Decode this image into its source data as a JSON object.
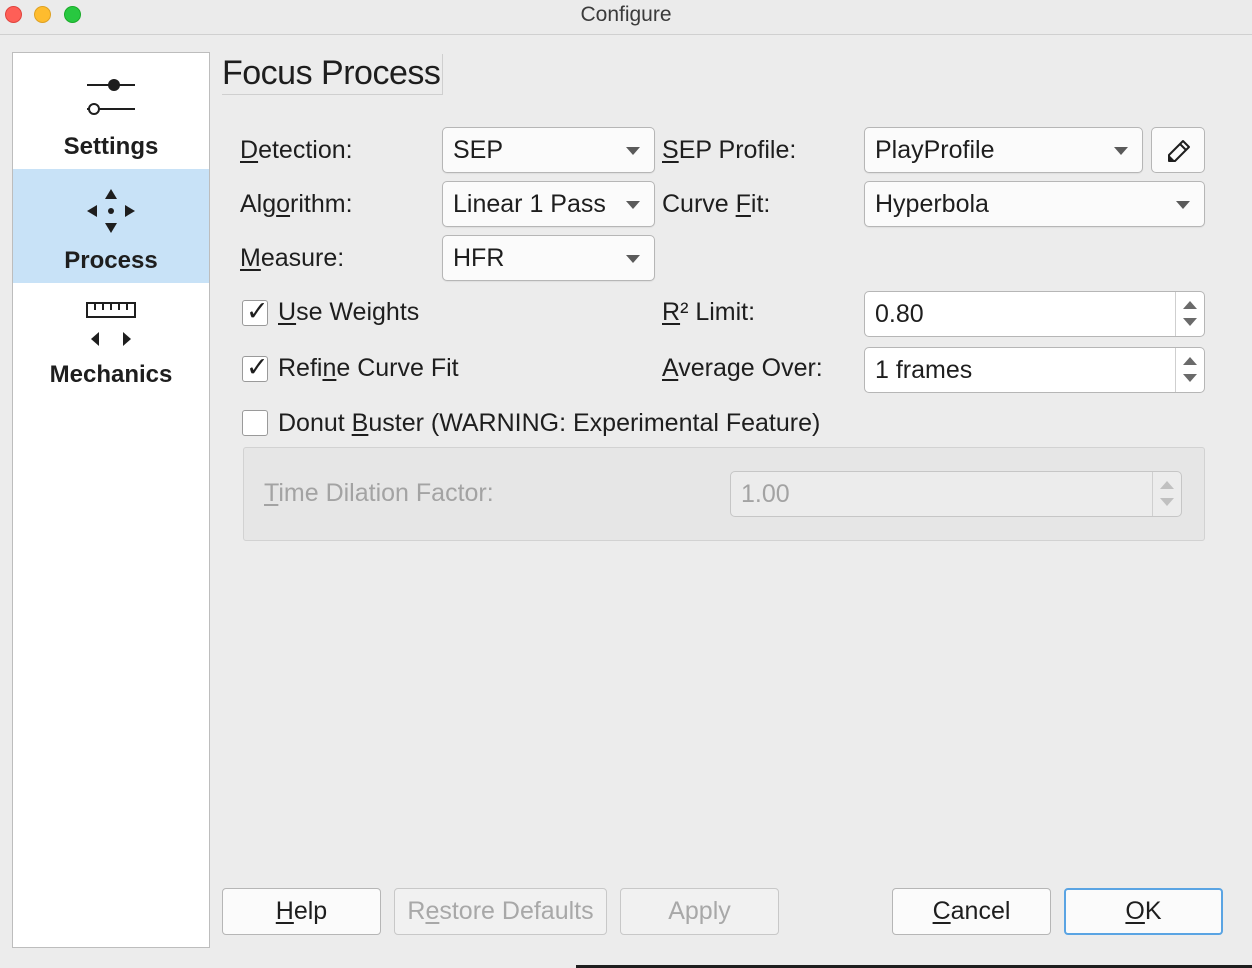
{
  "window": {
    "title": "Configure"
  },
  "sidebar": {
    "items": [
      {
        "label": "Settings",
        "icon": "sliders-icon",
        "active": false
      },
      {
        "label": "Process",
        "icon": "move-arrows-icon",
        "active": true
      },
      {
        "label": "Mechanics",
        "icon": "ruler-arrows-icon",
        "active": false
      }
    ]
  },
  "page": {
    "title": "Focus Process"
  },
  "form": {
    "detection": {
      "label_u": "D",
      "label_rest": "etection:",
      "value": "SEP"
    },
    "algorithm": {
      "label_pre": "Alg",
      "label_u": "o",
      "label_rest": "rithm:",
      "value": "Linear 1 Pass"
    },
    "measure": {
      "label_u": "M",
      "label_rest": "easure:",
      "value": "HFR"
    },
    "sep_profile": {
      "label_u": "S",
      "label_rest": "EP Profile:",
      "value": "PlayProfile",
      "edit_icon": "pencil-icon"
    },
    "curve_fit": {
      "label_pre": "Curve ",
      "label_u": "F",
      "label_rest": "it:",
      "value": "Hyperbola"
    },
    "use_weights": {
      "label_u": "U",
      "label_rest": "se Weights",
      "checked": true
    },
    "refine_curve_fit": {
      "label_pre": "Refi",
      "label_u": "n",
      "label_rest": "e Curve Fit",
      "checked": true
    },
    "r2_limit": {
      "label_u": "R",
      "label_rest": "² Limit:",
      "value": "0.80"
    },
    "average_over": {
      "label_u": "A",
      "label_rest": "verage Over:",
      "value": "1 frames"
    },
    "donut_buster": {
      "label_pre": "Donut ",
      "label_u": "B",
      "label_rest": "uster (WARNING: Experimental Feature)",
      "checked": false
    },
    "time_dilation": {
      "label_u": "T",
      "label_rest": "ime Dilation Factor:",
      "value": "1.00"
    },
    "check_mark": "✓"
  },
  "buttons": {
    "help": {
      "label_u": "H",
      "label_rest": "elp"
    },
    "restore_defaults": {
      "label_pre": "R",
      "label_u": "e",
      "label_rest": "store Defaults"
    },
    "apply": {
      "label": "Apply"
    },
    "cancel": {
      "label_u": "C",
      "label_rest": "ancel"
    },
    "ok": {
      "label_u": "O",
      "label_rest": "K"
    }
  }
}
